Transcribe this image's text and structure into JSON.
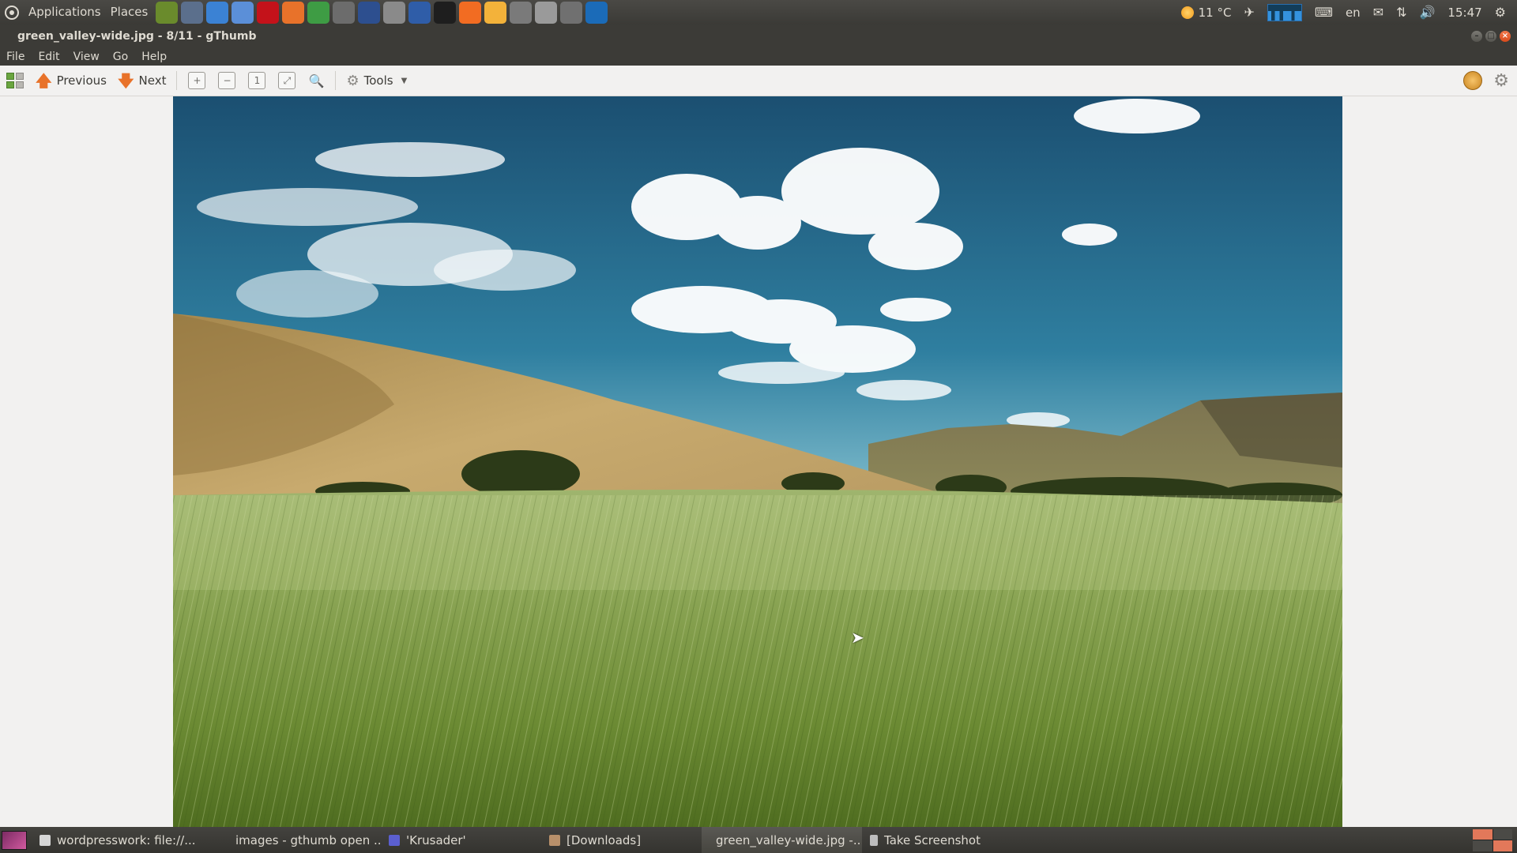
{
  "top_panel": {
    "menu": [
      "Applications",
      "Places"
    ],
    "launchers": [
      {
        "icon": "tools-icon",
        "color": "#6a8b2c"
      },
      {
        "icon": "network-icon",
        "color": "#5b6f8c"
      },
      {
        "icon": "chrome-icon",
        "color": "#3b82d4"
      },
      {
        "icon": "chromium-icon",
        "color": "#5b8fd8"
      },
      {
        "icon": "opera-icon",
        "color": "#c4121a"
      },
      {
        "icon": "firefox-icon",
        "color": "#e8722a"
      },
      {
        "icon": "chrome-alt-icon",
        "color": "#3e9c44"
      },
      {
        "icon": "wrench-icon",
        "color": "#6c6c6c"
      },
      {
        "icon": "screenshot-tool-icon",
        "color": "#2d4f8f"
      },
      {
        "icon": "text-editor-icon",
        "color": "#8a8a8a"
      },
      {
        "icon": "remote-desktop-icon",
        "color": "#2f5da8"
      },
      {
        "icon": "terminal-icon",
        "color": "#1e1e1e"
      },
      {
        "icon": "xampp-icon",
        "color": "#f26c22"
      },
      {
        "icon": "basket-icon",
        "color": "#f3b23a"
      },
      {
        "icon": "camera-icon",
        "color": "#7a7a7a"
      },
      {
        "icon": "camera-alt-icon",
        "color": "#9a9a9a"
      },
      {
        "icon": "calculator-icon",
        "color": "#707070"
      },
      {
        "icon": "virtualbox-icon",
        "color": "#1b6bb8"
      }
    ],
    "tray": {
      "temperature": "11 °C",
      "keyboard_layout": "en",
      "time": "15:47"
    }
  },
  "window": {
    "title": "green_valley-wide.jpg - 8/11 - gThumb"
  },
  "menubar": [
    "File",
    "Edit",
    "View",
    "Go",
    "Help"
  ],
  "toolbar": {
    "previous_label": "Previous",
    "next_label": "Next",
    "tools_label": "Tools"
  },
  "taskbar": {
    "tasks": [
      {
        "label": "wordpresswork: file://...",
        "icon": "text-editor-icon",
        "color": "#d6d6d6"
      },
      {
        "label": "images - gthumb open ...",
        "icon": "chrome-icon",
        "color": "#e8722a"
      },
      {
        "label": "'Krusader'",
        "icon": "krusader-icon",
        "color": "#5b5fd0"
      },
      {
        "label": "[Downloads]",
        "icon": "folder-icon",
        "color": "#b8906a"
      },
      {
        "label": "green_valley-wide.jpg -...",
        "icon": "gthumb-icon",
        "color": "#e0dcd4",
        "active": true
      },
      {
        "label": "Take Screenshot",
        "icon": "camera-icon",
        "color": "#bdbdbd"
      }
    ]
  }
}
